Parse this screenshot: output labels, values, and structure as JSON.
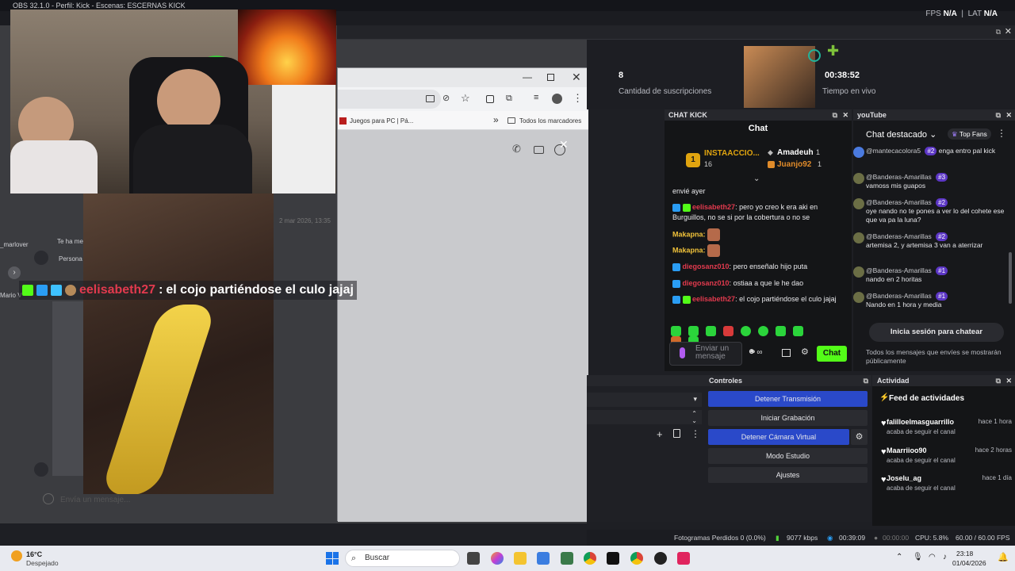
{
  "obs": {
    "title": "OBS 32.1.0 - Perfil: Kick - Escenas: ESCERNAS KICK",
    "fps_label": "FPS",
    "fps_value": "N/A",
    "lat_label": "LAT",
    "lat_value": "N/A"
  },
  "stats": {
    "subs_value": "8",
    "subs_label": "Cantidad de suscripciones",
    "live_time": "00:38:52",
    "live_label": "Tiempo en vivo"
  },
  "chrome": {
    "bookmark_1": "Juegos para PC | Pá...",
    "bookmark_all": "Todos los marcadores"
  },
  "dm": {
    "timestamp": "2 mar 2026, 13:35",
    "user_fragment": "_marlover",
    "snippet_1": "Te ha me",
    "snippet_2": "Persona",
    "snippet_3": "Mario V",
    "input_placeholder": "Envía un mensaje..."
  },
  "overlay_chat": {
    "user": "eelisabeth27",
    "separator": ":",
    "message": "el cojo partiéndose el culo jajaj"
  },
  "kick_chat": {
    "panel_title": "CHAT KICK",
    "title": "Chat",
    "top_gifter_name": "INSTAACCIO...",
    "top_gifter_count": "16",
    "top_rank": "1",
    "gifter_2": "Amadeuh",
    "gifter_2_count": "1",
    "gifter_3": "Juanjo92",
    "gifter_3_count": "1",
    "messages": [
      {
        "user": "",
        "text": "envié ayer"
      },
      {
        "user": "eelisabeth27",
        "text": "pero yo creo k era aki en Burguillos, no se si por la cobertura o no se"
      },
      {
        "user": "Makapna:",
        "text": ""
      },
      {
        "user": "Makapna:",
        "text": ""
      },
      {
        "user": "diegosanz010",
        "text": "pero enseñalo hijo puta"
      },
      {
        "user": "diegosanz010",
        "text": "ostiaa a que le he dao"
      },
      {
        "user": "eelisabeth27",
        "text": "el cojo partiéndose el culo jajaj"
      }
    ],
    "input_placeholder": "Enviar un mensaje",
    "send_label": "Chat"
  },
  "youtube_chat": {
    "panel_title": "youTube",
    "mode": "Chat destacado",
    "top_fans": "Top Fans",
    "messages": [
      {
        "user": "@mantecacolora5",
        "badge": "#2",
        "text": "enga entro pal kick"
      },
      {
        "user": "@Banderas-Amarillas",
        "badge": "#3",
        "text": "vamoss mis guapos"
      },
      {
        "user": "@Banderas-Amarillas",
        "badge": "#2",
        "text": "oye nando no te pones a ver lo del cohete ese que va pa la luna?"
      },
      {
        "user": "@Banderas-Amarillas",
        "badge": "#2",
        "text": "artemisa 2, y artemisa 3 van a aterrizar"
      },
      {
        "user": "@Banderas-Amarillas",
        "badge": "#1",
        "text": "nando en 2 horitas"
      },
      {
        "user": "@Banderas-Amarillas",
        "badge": "#1",
        "text": "Nando en 1 hora y media"
      }
    ],
    "login_button": "Inicia sesión para chatear",
    "notice": "Todos los mensajes que envíes se mostrarán públicamente"
  },
  "controls": {
    "title": "Controles",
    "stop_stream": "Detener Transmisión",
    "start_recording": "Iniciar Grabación",
    "stop_virtual_cam": "Detener Cámara Virtual",
    "studio_mode": "Modo Estudio",
    "settings": "Ajustes"
  },
  "activity": {
    "title": "Actividad",
    "feed_title": "Feed de actividades",
    "items": [
      {
        "name": "falilloelmasguarrillo",
        "time": "hace 1 hora",
        "sub": "acaba de seguir el canal"
      },
      {
        "name": "Maarriioo90",
        "time": "hace 2 horas",
        "sub": "acaba de seguir el canal"
      },
      {
        "name": "Joselu_ag",
        "time": "hace 1 día",
        "sub": "acaba de seguir el canal"
      }
    ]
  },
  "status": {
    "dropped": "Fotogramas Perdidos 0 (0.0%)",
    "bitrate": "9077 kbps",
    "stream_time": "00:39:09",
    "rec_time": "00:00:00",
    "cpu": "CPU: 5.8%",
    "fps": "60.00 / 60.00 FPS"
  },
  "taskbar": {
    "temp": "16°C",
    "weather": "Despejado",
    "search": "Buscar",
    "time": "23:18",
    "date": "01/04/2026"
  },
  "colors": {
    "kick_green": "#53fc18",
    "obs_blue": "#2a49c9",
    "kick_user_red": "#e23a4e",
    "yt_badge": "#5c36c5"
  }
}
